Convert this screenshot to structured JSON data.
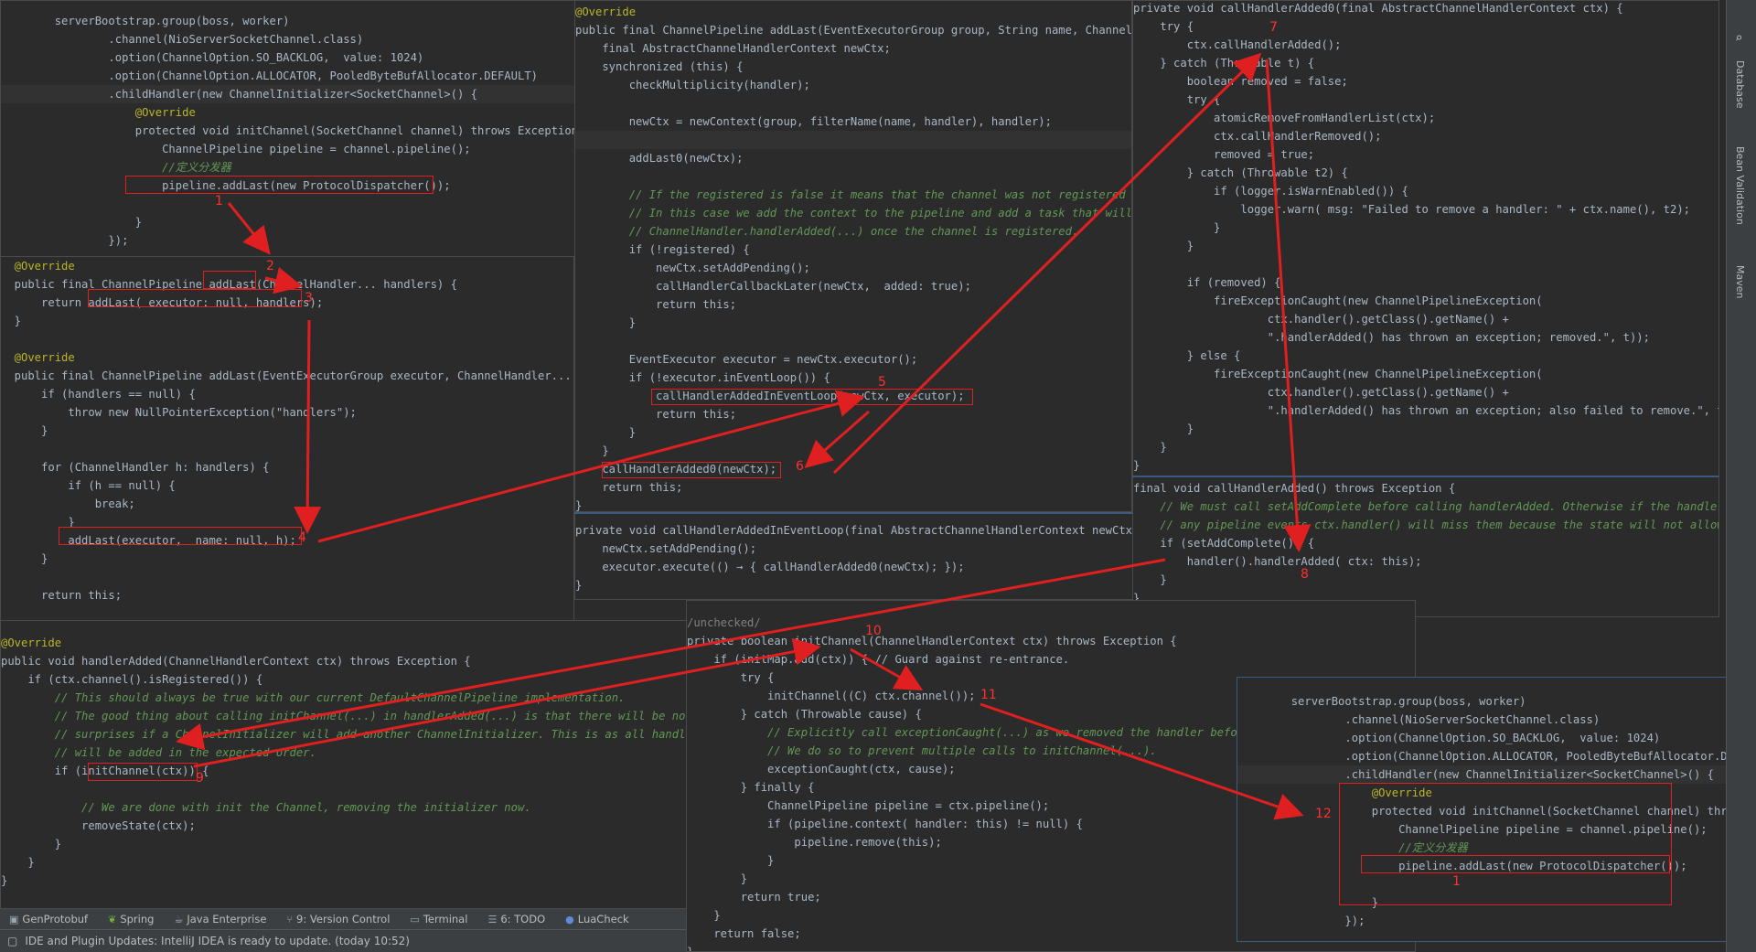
{
  "panels": {
    "p1": {
      "lines": [
        "        serverBootstrap.group(boss, worker)",
        "                .channel(NioServerSocketChannel.class)",
        "                .option(ChannelOption.SO_BACKLOG,  value: 1024)",
        "                .option(ChannelOption.ALLOCATOR, PooledByteBufAllocator.DEFAULT)",
        "                .childHandler(new ChannelInitializer<SocketChannel>() {",
        "                    @Override",
        "                    protected void initChannel(SocketChannel channel) throws Exception {",
        "                        ChannelPipeline pipeline = channel.pipeline();",
        "                        //定义分发器",
        "                        pipeline.addLast(new ProtocolDispatcher());",
        "",
        "                    }",
        "                });"
      ]
    },
    "p2": {
      "lines": [
        "  @Override",
        "  public final ChannelPipeline addLast(ChannelHandler... handlers) {",
        "      return addLast( executor: null, handlers);",
        "  }",
        "",
        "  @Override",
        "  public final ChannelPipeline addLast(EventExecutorGroup executor, ChannelHandler... han",
        "      if (handlers == null) {",
        "          throw new NullPointerException(\"handlers\");",
        "      }",
        "",
        "      for (ChannelHandler h: handlers) {",
        "          if (h == null) {",
        "              break;",
        "          }",
        "          addLast(executor,  name: null, h);",
        "      }",
        "",
        "      return this;"
      ]
    },
    "p3": {
      "lines": [
        "@Override",
        "public final ChannelPipeline addLast(EventExecutorGroup group, String name, ChannelHan",
        "    final AbstractChannelHandlerContext newCtx;",
        "    synchronized (this) {",
        "        checkMultiplicity(handler);",
        "",
        "        newCtx = newContext(group, filterName(name, handler), handler);",
        "",
        "        addLast0(newCtx);",
        "",
        "        // If the registered is false it means that the channel was not registered on",
        "        // In this case we add the context to the pipeline and add a task that will ca",
        "        // ChannelHandler.handlerAdded(...) once the channel is registered.",
        "        if (!registered) {",
        "            newCtx.setAddPending();",
        "            callHandlerCallbackLater(newCtx,  added: true);",
        "            return this;",
        "        }",
        "",
        "        EventExecutor executor = newCtx.executor();",
        "        if (!executor.inEventLoop()) {",
        "            callHandlerAddedInEventLoop(newCtx, executor);",
        "            return this;",
        "        }",
        "    }",
        "    callHandlerAdded0(newCtx);",
        "    return this;",
        "}"
      ]
    },
    "p4": {
      "lines": [
        "private void callHandlerAddedInEventLoop(final AbstractChannelHandlerContext newCtx, Ev",
        "    newCtx.setAddPending();",
        "    executor.execute(() → { callHandlerAdded0(newCtx); });",
        "}"
      ]
    },
    "p5": {
      "lines": [
        "private void callHandlerAdded0(final AbstractChannelHandlerContext ctx) {",
        "    try {",
        "        ctx.callHandlerAdded();",
        "    } catch (Throwable t) {",
        "        boolean removed = false;",
        "        try {",
        "            atomicRemoveFromHandlerList(ctx);",
        "            ctx.callHandlerRemoved();",
        "            removed = true;",
        "        } catch (Throwable t2) {",
        "            if (logger.isWarnEnabled()) {",
        "                logger.warn( msg: \"Failed to remove a handler: \" + ctx.name(), t2);",
        "            }",
        "        }",
        "",
        "        if (removed) {",
        "            fireExceptionCaught(new ChannelPipelineException(",
        "                    ctx.handler().getClass().getName() +",
        "                    \".handlerAdded() has thrown an exception; removed.\", t));",
        "        } else {",
        "            fireExceptionCaught(new ChannelPipelineException(",
        "                    ctx.handler().getClass().getName() +",
        "                    \".handlerAdded() has thrown an exception; also failed to remove.\", t));",
        "        }",
        "    }",
        "}"
      ]
    },
    "p6": {
      "lines": [
        "final void callHandlerAdded() throws Exception {",
        "    // We must call setAddComplete before calling handlerAdded. Otherwise if the handlerAd",
        "    // any pipeline events ctx.handler() will miss them because the state will not allow i",
        "    if (setAddComplete()) {",
        "        handler().handlerAdded( ctx: this);",
        "    }",
        "}"
      ]
    },
    "p7": {
      "lines": [
        "@Override",
        "public void handlerAdded(ChannelHandlerContext ctx) throws Exception {",
        "    if (ctx.channel().isRegistered()) {",
        "        // This should always be true with our current DefaultChannelPipeline implementation.",
        "        // The good thing about calling initChannel(...) in handlerAdded(...) is that there will be no or",
        "        // surprises if a ChannelInitializer will add another ChannelInitializer. This is as all handlers",
        "        // will be added in the expected order.",
        "        if (initChannel(ctx)) {",
        "",
        "            // We are done with init the Channel, removing the initializer now.",
        "            removeState(ctx);",
        "        }",
        "    }",
        "}"
      ]
    },
    "p8": {
      "lines": [
        "/unchecked/",
        "private boolean initChannel(ChannelHandlerContext ctx) throws Exception {",
        "    if (initMap.add(ctx)) { // Guard against re-entrance.",
        "        try {",
        "            initChannel((C) ctx.channel());",
        "        } catch (Throwable cause) {",
        "            // Explicitly call exceptionCaught(...) as we removed the handler before",
        "            // We do so to prevent multiple calls to initChannel(...).",
        "            exceptionCaught(ctx, cause);",
        "        } finally {",
        "            ChannelPipeline pipeline = ctx.pipeline();",
        "            if (pipeline.context( handler: this) != null) {",
        "                pipeline.remove(this);",
        "            }",
        "        }",
        "        return true;",
        "    }",
        "    return false;",
        "}"
      ]
    },
    "p9": {
      "lines": [
        "        serverBootstrap.group(boss, worker)",
        "                .channel(NioServerSocketChannel.class)",
        "                .option(ChannelOption.SO_BACKLOG,  value: 1024)",
        "                .option(ChannelOption.ALLOCATOR, PooledByteBufAllocator.DEFAULT)",
        "                .childHandler(new ChannelInitializer<SocketChannel>() {",
        "                    @Override",
        "                    protected void initChannel(SocketChannel channel) throws Excepti",
        "                        ChannelPipeline pipeline = channel.pipeline();",
        "                        //定义分发器",
        "                        pipeline.addLast(new ProtocolDispatcher());",
        "",
        "                    }",
        "                });"
      ]
    }
  },
  "steps": [
    "1",
    "2",
    "3",
    "4",
    "5",
    "6",
    "7",
    "8",
    "9",
    "10",
    "11",
    "12",
    "1"
  ],
  "toolwindow_tabs": [
    {
      "icon": "protobuf-icon",
      "label": "GenProtobuf"
    },
    {
      "icon": "spring-icon",
      "label": "Spring"
    },
    {
      "icon": "java-enterprise-icon",
      "label": "Java Enterprise"
    },
    {
      "icon": "version-control-icon",
      "label": "9: Version Control"
    },
    {
      "icon": "terminal-icon",
      "label": "Terminal"
    },
    {
      "icon": "todo-icon",
      "label": "6: TODO"
    },
    {
      "icon": "luacheck-icon",
      "label": "LuaCheck"
    }
  ],
  "status_text": "IDE and Plugin Updates: IntelliJ IDEA is ready to update. (today 10:52)",
  "right_sidebar_tabs": [
    "Database",
    "Bean Validation",
    "Maven"
  ],
  "colors": {
    "annotation_red": "#e02020",
    "editor_bg": "#2b2b2b",
    "keyword": "#cc7832",
    "method": "#ffc66d",
    "comment": "#629755"
  }
}
